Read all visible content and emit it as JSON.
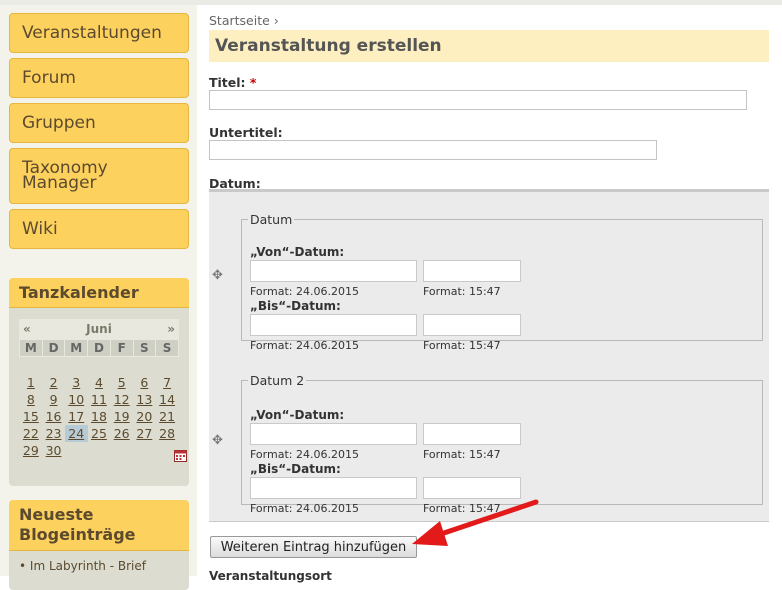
{
  "nav": [
    {
      "label": "Veranstaltungen"
    },
    {
      "label": "Forum"
    },
    {
      "label": "Gruppen"
    },
    {
      "label": "Taxonomy Manager"
    },
    {
      "label": "Wiki"
    }
  ],
  "calendar_block": {
    "title": "Tanzkalender",
    "prev": "«",
    "next": "»",
    "month": "Juni",
    "weekdays": [
      "M",
      "D",
      "M",
      "D",
      "F",
      "S",
      "S"
    ],
    "weeks": [
      [
        "",
        "",
        "",
        "",
        "",
        "",
        ""
      ],
      [
        "1",
        "2",
        "3",
        "4",
        "5",
        "6",
        "7"
      ],
      [
        "8",
        "9",
        "10",
        "11",
        "12",
        "13",
        "14"
      ],
      [
        "15",
        "16",
        "17",
        "18",
        "19",
        "20",
        "21"
      ],
      [
        "22",
        "23",
        "24",
        "25",
        "26",
        "27",
        "28"
      ],
      [
        "29",
        "30",
        "",
        "",
        "",
        "",
        ""
      ]
    ],
    "today": "24"
  },
  "blog_block": {
    "title": "Neueste Blogeinträge",
    "items": [
      "Im Labyrinth - Brief"
    ]
  },
  "breadcrumb": {
    "home": "Startseite",
    "sep": " ›"
  },
  "page_title": "Veranstaltung erstellen",
  "form": {
    "title_label": "Titel:",
    "required_mark": "*",
    "subtitle_label": "Untertitel:",
    "date_label": "Datum:",
    "date_groups": [
      {
        "legend": "Datum",
        "from_label": "„Von“-Datum:",
        "to_label": "„Bis“-Datum:",
        "date_format": "Format: 24.06.2015",
        "time_format": "Format: 15:47"
      },
      {
        "legend": "Datum 2",
        "from_label": "„Von“-Datum:",
        "to_label": "„Bis“-Datum:",
        "date_format": "Format: 24.06.2015",
        "time_format": "Format: 15:47"
      }
    ],
    "add_button": "Weiteren Eintrag hinzufügen",
    "next_label_cut": "Veranstaltungsort"
  },
  "colors": {
    "accent": "#fdd15e",
    "title_bg": "#fdefc0",
    "arrow": "#e21a1a"
  }
}
